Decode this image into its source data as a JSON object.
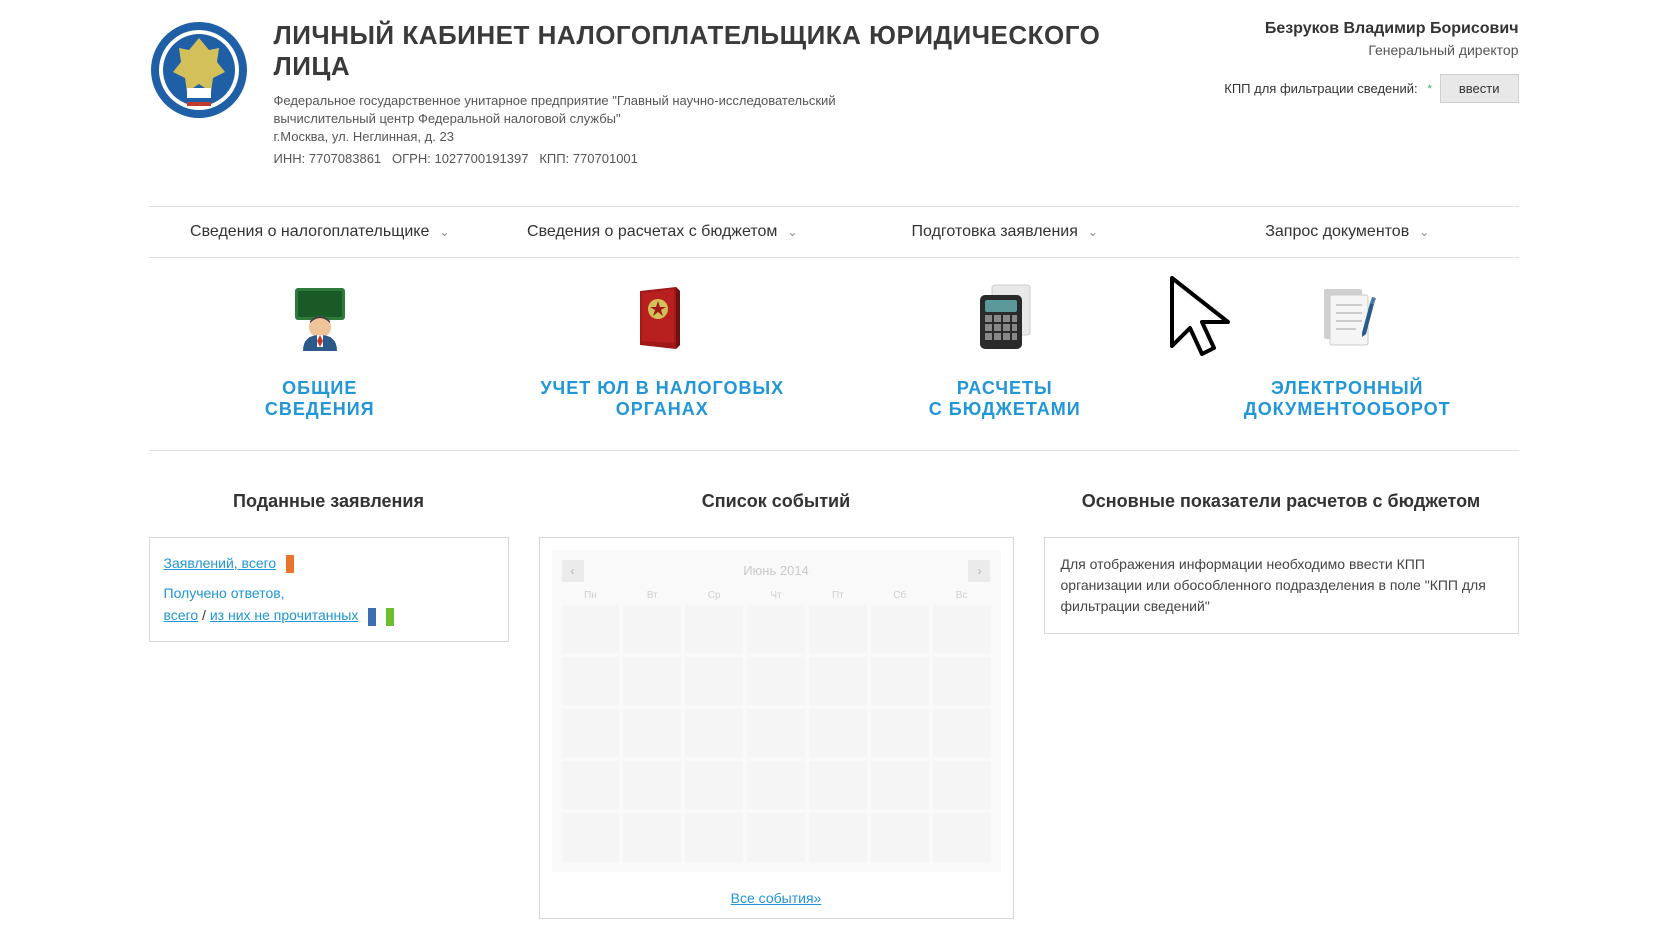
{
  "header": {
    "title": "ЛИЧНЫЙ КАБИНЕТ НАЛОГОПЛАТЕЛЬЩИКА ЮРИДИЧЕСКОГО ЛИЦА",
    "org_desc_line1": "Федеральное государственное унитарное предприятие \"Главный научно-исследовательский",
    "org_desc_line2": "вычислительный центр Федеральной налоговой службы\"",
    "org_address": "г.Москва, ул. Неглинная, д. 23",
    "inn_label": "ИНН:",
    "inn": "7707083861",
    "ogrn_label": "ОГРН:",
    "ogrn": "1027700191397",
    "kpp_label": "КПП:",
    "kpp": "770701001"
  },
  "user": {
    "name": "Безруков Владимир Борисович",
    "role": "Генеральный директор",
    "kpp_filter_label": "КПП для фильтрации сведений:",
    "enter_btn": "ввести"
  },
  "nav": {
    "taxpayer": "Сведения о налогоплательщике",
    "budget": "Сведения о расчетах с бюджетом",
    "application": "Подготовка заявления",
    "documents": "Запрос документов"
  },
  "tiles": {
    "general": "ОБЩИЕ\nСВЕДЕНИЯ",
    "registration": "УЧЕТ ЮЛ В НАЛОГОВЫХ\nОРГАНАХ",
    "budgets": "РАСЧЕТЫ\nС БЮДЖЕТАМИ",
    "edoc": "ЭЛЕКТРОННЫЙ\nДОКУМЕНТООБОРОТ"
  },
  "panels": {
    "applications": {
      "title": "Поданные заявления",
      "total_link": "Заявлений, всего",
      "answers_label": "Получено ответов,",
      "answers_total": "всего",
      "answers_sep": " / ",
      "answers_unread": "из них не прочитанных"
    },
    "events": {
      "title": "Список событий",
      "month": "Июнь 2014",
      "all_link": "Все события»"
    },
    "indicators": {
      "title": "Основные показатели расчетов с бюджетом",
      "note": "Для отображения информации необходимо ввести КПП организации или обособленного подразделения в поле \"КПП для фильтрации сведений\""
    }
  }
}
